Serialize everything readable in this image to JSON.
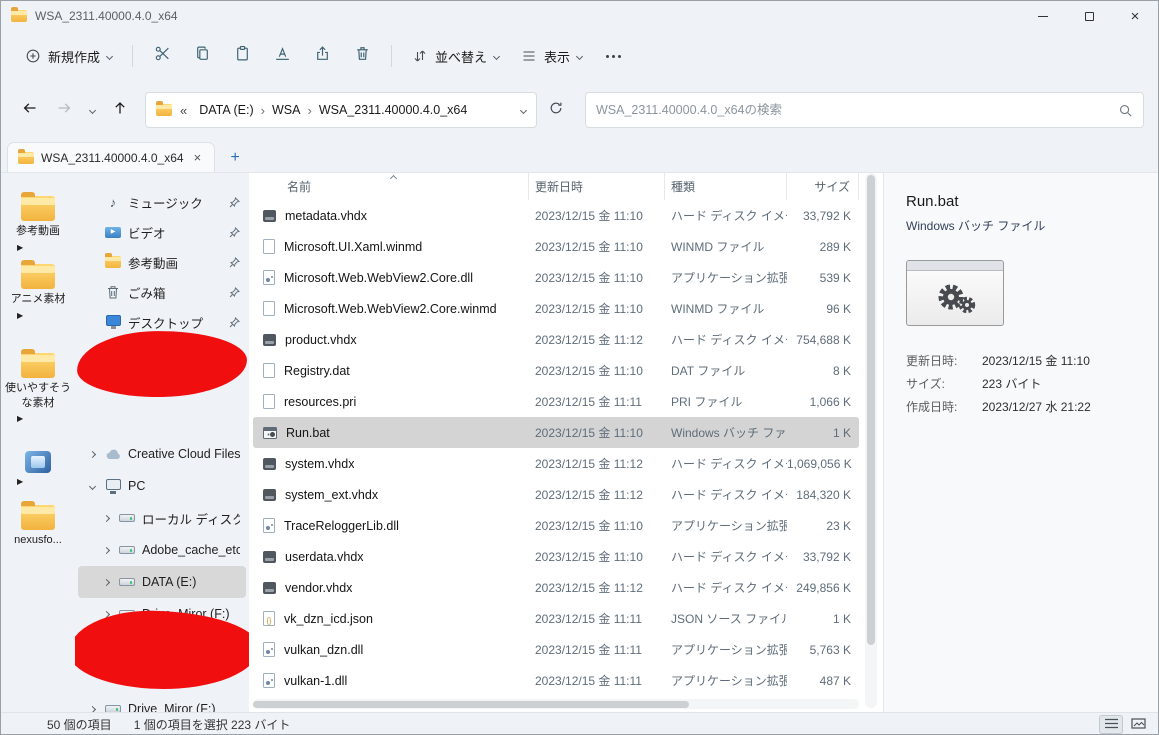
{
  "window": {
    "title": "WSA_2311.40000.4.0_x64"
  },
  "commandbar": {
    "new_label": "新規作成",
    "sort_label": "並べ替え",
    "view_label": "表示"
  },
  "addressbar": {
    "collapsed_indicator": "«",
    "crumbs": [
      "DATA (E:)",
      "WSA",
      "WSA_2311.40000.4.0_x64"
    ],
    "search_placeholder": "WSA_2311.40000.4.0_x64の検索"
  },
  "tabbar": {
    "tab_label": "WSA_2311.40000.4.0_x64",
    "new_tab_label": "+"
  },
  "desktop_strip": [
    {
      "icon": "folder",
      "label": "参考動画",
      "expander": true
    },
    {
      "icon": "folder",
      "label": "アニメ素材",
      "expander": true
    },
    {
      "icon": "folder",
      "label": "使いやすそうな素材",
      "expander": true
    },
    {
      "icon": "app",
      "label": "",
      "expander": true
    },
    {
      "icon": "folder",
      "label": "nexusfo...",
      "expander": false
    }
  ],
  "sidebar": {
    "pinned": [
      {
        "icon": "music",
        "label": "ミュージック"
      },
      {
        "icon": "video",
        "label": "ビデオ"
      },
      {
        "icon": "folder",
        "label": "参考動画"
      },
      {
        "icon": "recycle",
        "label": "ごみ箱"
      },
      {
        "icon": "desktop",
        "label": "デスクトップ"
      }
    ],
    "tree": [
      {
        "icon": "cloud",
        "label": "Creative Cloud Files",
        "chevron": "right",
        "indent": 0,
        "selected": false
      },
      {
        "icon": "pc",
        "label": "PC",
        "chevron": "down",
        "indent": 0,
        "selected": false
      },
      {
        "icon": "drive",
        "label": "ローカル ディスク (C:)",
        "chevron": "right",
        "indent": 1,
        "selected": false
      },
      {
        "icon": "drive",
        "label": "Adobe_cache_etc (D:",
        "chevron": "right",
        "indent": 1,
        "selected": false
      },
      {
        "icon": "drive",
        "label": "DATA (E:)",
        "chevron": "right",
        "indent": 1,
        "selected": true
      },
      {
        "icon": "drive",
        "label": "Drive_Miror (F:)",
        "chevron": "right",
        "indent": 1,
        "selected": false
      },
      {
        "icon": "drive",
        "label": "Drive_Miror (F:)",
        "chevron": "right",
        "indent": 0,
        "selected": false
      }
    ]
  },
  "filelist": {
    "columns": [
      "名前",
      "更新日時",
      "種類",
      "サイズ"
    ],
    "sort": {
      "column": "名前",
      "direction": "asc"
    },
    "rows": [
      {
        "icon": "disk",
        "name": "metadata.vhdx",
        "date": "2023/12/15 金 11:10",
        "type": "ハード ディスク イメー...",
        "size": "33,792 K",
        "selected": false
      },
      {
        "icon": "page",
        "name": "Microsoft.UI.Xaml.winmd",
        "date": "2023/12/15 金 11:10",
        "type": "WINMD ファイル",
        "size": "289 K",
        "selected": false
      },
      {
        "icon": "dll",
        "name": "Microsoft.Web.WebView2.Core.dll",
        "date": "2023/12/15 金 11:10",
        "type": "アプリケーション拡張",
        "size": "539 K",
        "selected": false
      },
      {
        "icon": "page",
        "name": "Microsoft.Web.WebView2.Core.winmd",
        "date": "2023/12/15 金 11:10",
        "type": "WINMD ファイル",
        "size": "96 K",
        "selected": false
      },
      {
        "icon": "disk",
        "name": "product.vhdx",
        "date": "2023/12/15 金 11:12",
        "type": "ハード ディスク イメー...",
        "size": "754,688 K",
        "selected": false
      },
      {
        "icon": "page",
        "name": "Registry.dat",
        "date": "2023/12/15 金 11:10",
        "type": "DAT ファイル",
        "size": "8 K",
        "selected": false
      },
      {
        "icon": "page",
        "name": "resources.pri",
        "date": "2023/12/15 金 11:11",
        "type": "PRI ファイル",
        "size": "1,066 K",
        "selected": false
      },
      {
        "icon": "bat",
        "name": "Run.bat",
        "date": "2023/12/15 金 11:10",
        "type": "Windows バッチ ファ...",
        "size": "1 K",
        "selected": true
      },
      {
        "icon": "disk",
        "name": "system.vhdx",
        "date": "2023/12/15 金 11:12",
        "type": "ハード ディスク イメー...",
        "size": "1,069,056 K",
        "selected": false
      },
      {
        "icon": "disk",
        "name": "system_ext.vhdx",
        "date": "2023/12/15 金 11:12",
        "type": "ハード ディスク イメー...",
        "size": "184,320 K",
        "selected": false
      },
      {
        "icon": "dll",
        "name": "TraceReloggerLib.dll",
        "date": "2023/12/15 金 11:10",
        "type": "アプリケーション拡張",
        "size": "23 K",
        "selected": false
      },
      {
        "icon": "disk",
        "name": "userdata.vhdx",
        "date": "2023/12/15 金 11:10",
        "type": "ハード ディスク イメー...",
        "size": "33,792 K",
        "selected": false
      },
      {
        "icon": "disk",
        "name": "vendor.vhdx",
        "date": "2023/12/15 金 11:12",
        "type": "ハード ディスク イメー...",
        "size": "249,856 K",
        "selected": false
      },
      {
        "icon": "json",
        "name": "vk_dzn_icd.json",
        "date": "2023/12/15 金 11:11",
        "type": "JSON ソース ファイル",
        "size": "1 K",
        "selected": false
      },
      {
        "icon": "dll",
        "name": "vulkan_dzn.dll",
        "date": "2023/12/15 金 11:11",
        "type": "アプリケーション拡張",
        "size": "5,763 K",
        "selected": false
      },
      {
        "icon": "dll",
        "name": "vulkan-1.dll",
        "date": "2023/12/15 金 11:11",
        "type": "アプリケーション拡張",
        "size": "487 K",
        "selected": false
      }
    ]
  },
  "preview": {
    "filename": "Run.bat",
    "filetype": "Windows バッチ ファイル",
    "details": [
      {
        "label": "更新日時:",
        "value": "2023/12/15 金 11:10"
      },
      {
        "label": "サイズ:",
        "value": "223 バイト"
      },
      {
        "label": "作成日時:",
        "value": "2023/12/27 水 21:22"
      }
    ]
  },
  "statusbar": {
    "items_count": "50 個の項目",
    "selection": "1 個の項目を選択 223 バイト"
  },
  "colors": {
    "accent": "#2f6fb3",
    "redaction": "#f10e0e",
    "selected_row": "#d4d4d4",
    "secondary_text": "#5f6d7a"
  }
}
